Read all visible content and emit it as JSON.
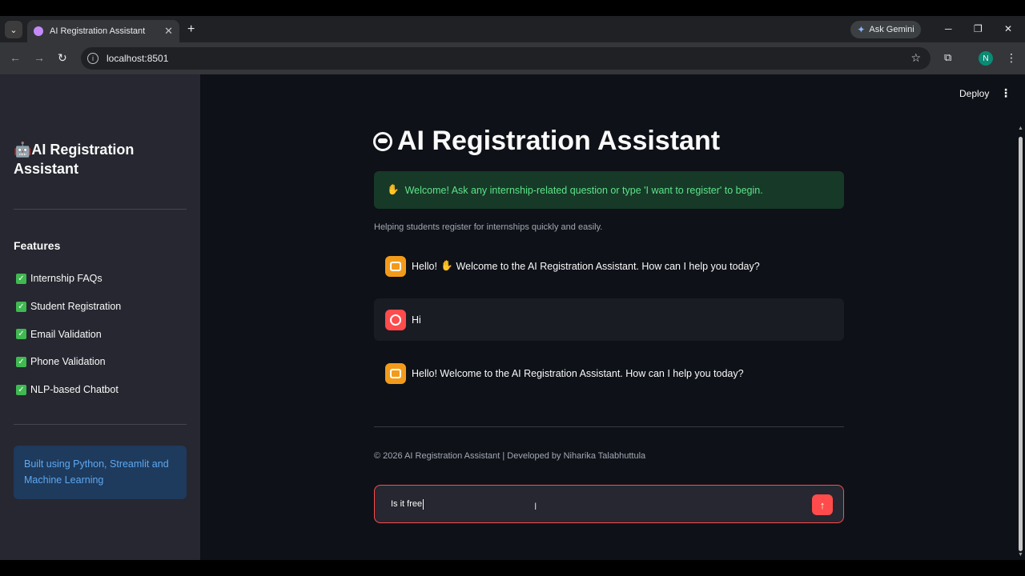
{
  "browser": {
    "tab_title": "AI Registration Assistant",
    "new_tab_label": "+",
    "gemini_label": "Ask Gemini",
    "url": "localhost:8501",
    "profile_initial": "N"
  },
  "header": {
    "deploy_label": "Deploy"
  },
  "sidebar": {
    "title": "🤖AI Registration Assistant",
    "features_heading": "Features",
    "features": [
      "Internship FAQs",
      "Student Registration",
      "Email Validation",
      "Phone Validation",
      "NLP-based Chatbot"
    ],
    "info_box": "Built using Python, Streamlit and Machine Learning"
  },
  "main": {
    "title": "AI Registration Assistant",
    "welcome": "Welcome! Ask any internship-related question or type 'I want to register' to begin.",
    "caption": "Helping students register for internships quickly and easily.",
    "messages": [
      {
        "role": "assistant",
        "pre": "Hello!",
        "post": "Welcome to the AI Registration Assistant. How can I help you today?"
      },
      {
        "role": "user",
        "text": "Hi"
      },
      {
        "role": "assistant",
        "text": "Hello! Welcome to the AI Registration Assistant. How can I help you today?"
      }
    ],
    "footer": "© 2026 AI Registration Assistant | Developed by Niharika Talabhuttula",
    "chat_input": {
      "value": "Is it free"
    }
  },
  "colors": {
    "accent": "#ff4b4b",
    "bot_avatar": "#f29b1b",
    "success_bg": "#173928",
    "success_text": "#5ce488",
    "info_bg": "#1e3a5c",
    "info_text": "#5ea8f2"
  },
  "icons": {
    "wave": "waving-hand-icon",
    "check": "check-box-icon",
    "send": "arrow-up-icon"
  }
}
